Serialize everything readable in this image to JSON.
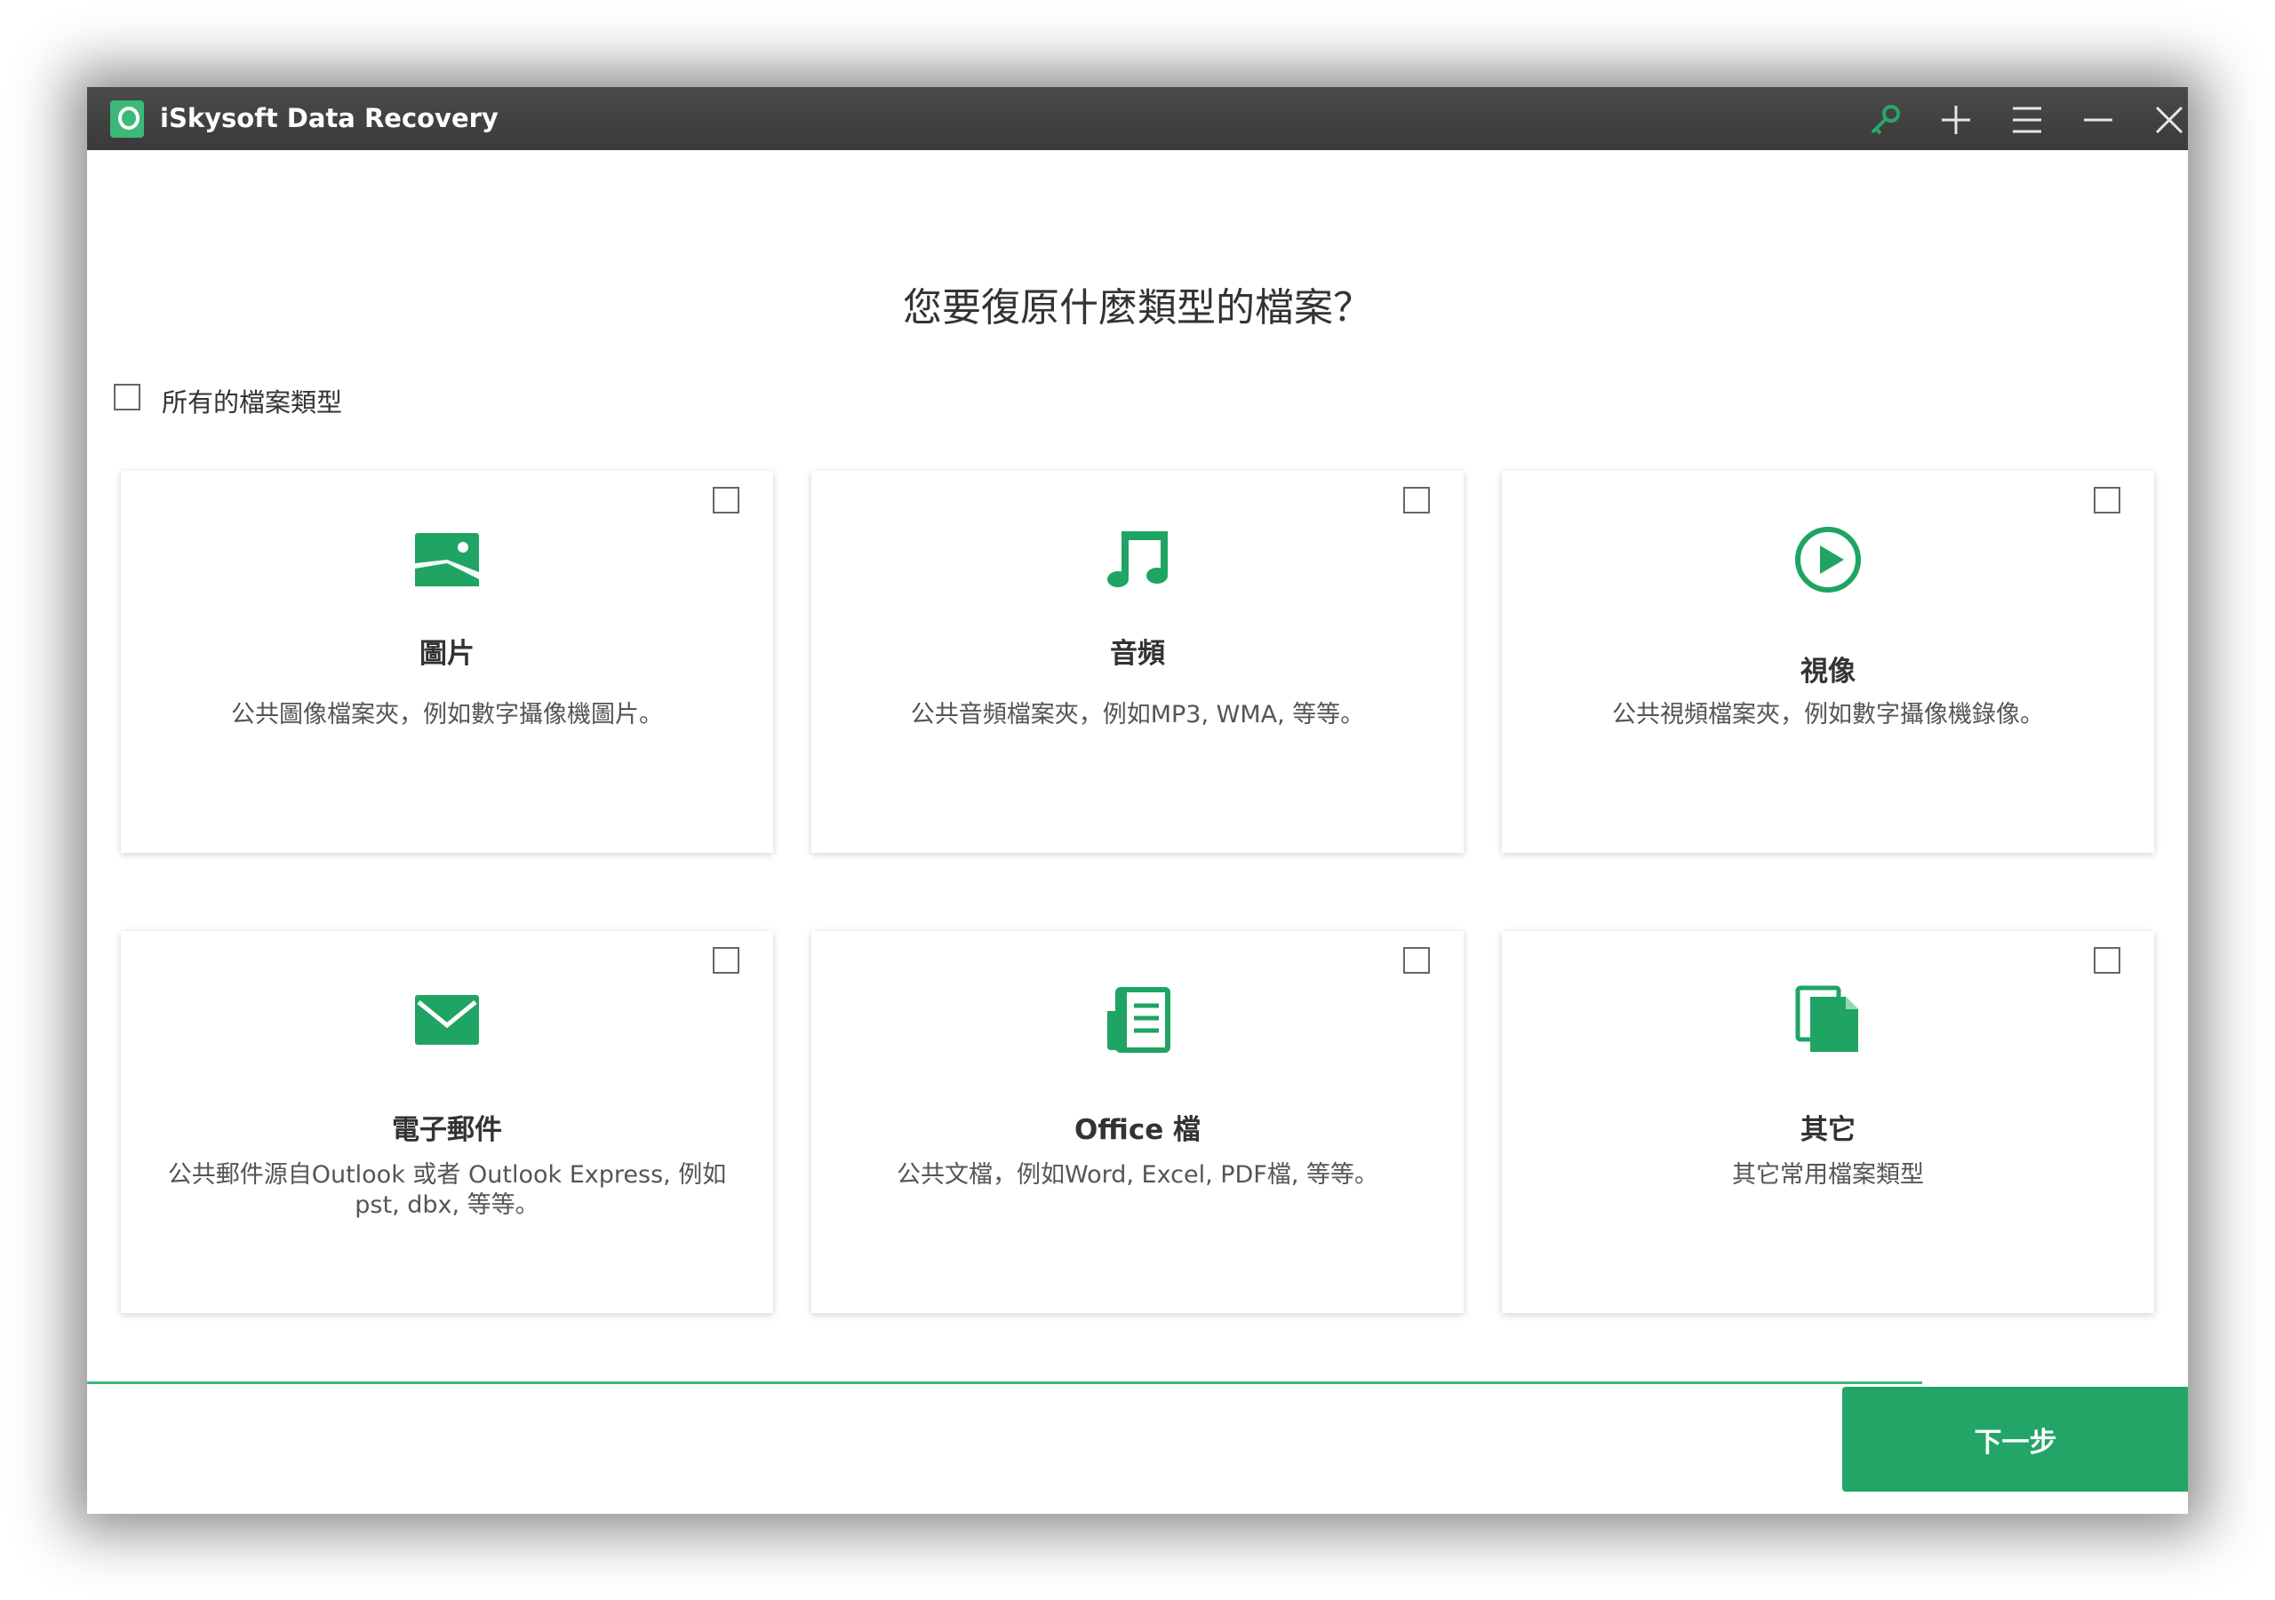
{
  "window": {
    "title": "iSkysoft Data Recovery"
  },
  "titlebar": {
    "icons": [
      "key-icon",
      "plus-icon",
      "menu-icon",
      "minimize-icon",
      "close-icon"
    ]
  },
  "question": "您要復原什麼類型的檔案？",
  "all_types_label": "所有的檔案類型",
  "accent_color": "#22a567",
  "cards": [
    {
      "title": "圖片",
      "desc": "公共圖像檔案夾，例如數字攝像機圖片。",
      "icon": "image-icon"
    },
    {
      "title": "音頻",
      "desc": "公共音頻檔案夾，例如MP3, WMA, 等等。",
      "icon": "music-icon"
    },
    {
      "title": "視像",
      "desc": "公共視頻檔案夾，例如數字攝像機錄像。",
      "icon": "play-icon"
    },
    {
      "title": "電子郵件",
      "desc": "公共郵件源自Outlook 或者 Outlook Express, 例如 pst, dbx, 等等。",
      "icon": "email-icon"
    },
    {
      "title": "Office 檔",
      "desc": "公共文檔，例如Word, Excel, PDF檔, 等等。",
      "icon": "document-icon"
    },
    {
      "title": "其它",
      "desc": "其它常用檔案類型",
      "icon": "files-icon"
    }
  ],
  "next_button": "下一步"
}
